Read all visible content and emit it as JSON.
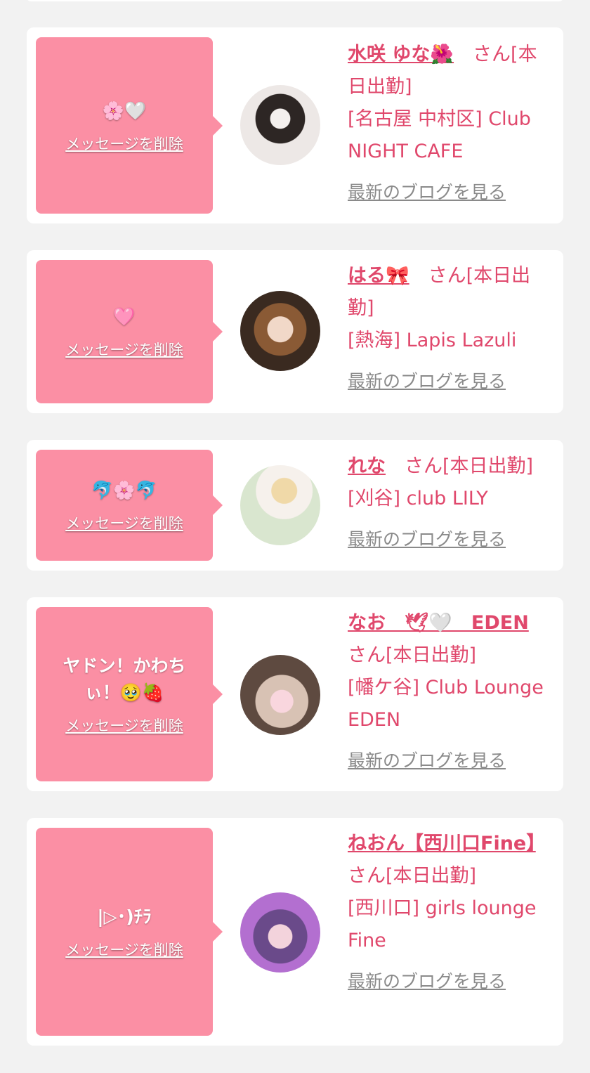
{
  "delete_label": "メッセージを削除",
  "blog_label": "最新のブログを見る",
  "items": [
    {
      "message": "🌸🤍",
      "name": "水咲 ゆな🌺",
      "suffix": "　さん[本日出勤]",
      "shop": "[名古屋 中村区] Club NIGHT CAFE"
    },
    {
      "message": "🩷",
      "name": "はる🎀",
      "suffix": "　さん[本日出勤]",
      "shop": "[熱海] Lapis Lazuli"
    },
    {
      "message": "🐬🌸🐬",
      "name": "れな",
      "suffix": "　さん[本日出勤]",
      "shop": "[刈谷] club LILY"
    },
    {
      "message": "ヤドン！かわちぃ！🥹🍓",
      "name": "なお　🕊🤍　EDEN",
      "suffix": " さん[本日出勤]",
      "shop": "[幡ケ谷] Club Lounge EDEN"
    },
    {
      "message": "|▷･)ﾁﾗ",
      "name": "ねおん【西川口Fine】",
      "suffix": "　さん[本日出勤]",
      "shop": "[西川口] girls lounge Fine"
    }
  ],
  "colors": {
    "bubble": "#fb8fa4",
    "accent": "#e0486c",
    "muted": "#8a8a8a",
    "background": "#f2f2f2"
  }
}
